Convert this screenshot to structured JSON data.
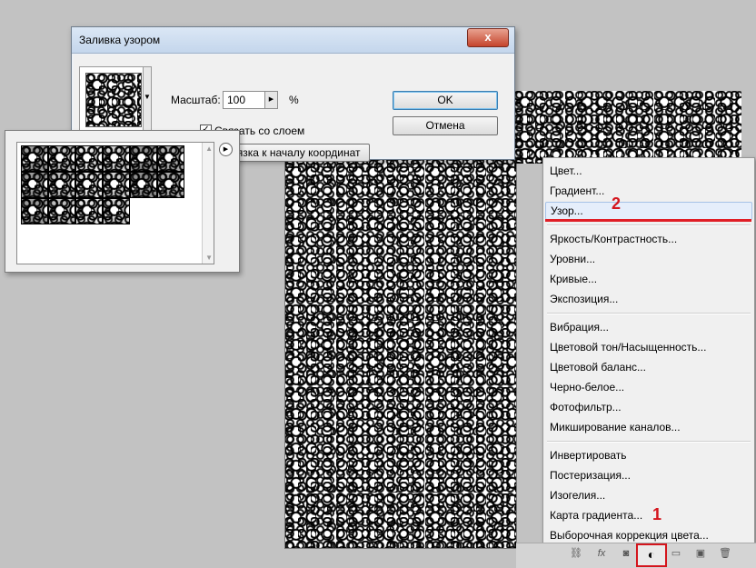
{
  "dialog": {
    "title": "Заливка узором",
    "close_label": "x",
    "scale_label": "Масштаб:",
    "scale_value": "100",
    "percent_label": "%",
    "link_label": "Связать со слоем",
    "link_checked": true,
    "snap_button_label": "Привязка к началу координат",
    "ok_label": "OK",
    "cancel_label": "Отмена"
  },
  "pattern_picker": {
    "rows": 3,
    "columns": 6,
    "thumb_count": 16
  },
  "adjustment_menu": {
    "groups": [
      [
        "Цвет...",
        "Градиент...",
        "Узор..."
      ],
      [
        "Яркость/Контрастность...",
        "Уровни...",
        "Кривые...",
        "Экспозиция..."
      ],
      [
        "Вибрация...",
        "Цветовой тон/Насыщенность...",
        "Цветовой баланс...",
        "Черно-белое...",
        "Фотофильтр...",
        "Микширование каналов..."
      ],
      [
        "Инвертировать",
        "Постеризация...",
        "Изогелия...",
        "Карта градиента...",
        "Выборочная коррекция цвета..."
      ]
    ],
    "highlighted": "Узор..."
  },
  "annotations": {
    "step_1": "1",
    "step_2": "2",
    "color": "#d4151d"
  },
  "layers_bar": {
    "icons": [
      "link-icon",
      "fx-icon",
      "mask-icon",
      "adjustment-layer-icon",
      "group-icon",
      "new-layer-icon",
      "trash-icon"
    ]
  }
}
